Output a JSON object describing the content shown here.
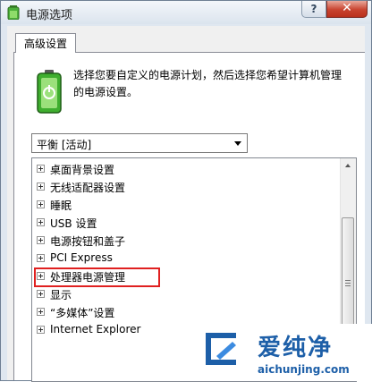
{
  "window": {
    "title": "电源选项",
    "help_label": "?",
    "close_label": "✕"
  },
  "tab": {
    "label": "高级设置"
  },
  "description": "选择您要自定义的电源计划，然后选择您希望计算机管理的电源设置。",
  "plan_select": {
    "value": "平衡 [活动]"
  },
  "tree_items": [
    "桌面背景设置",
    "无线适配器设置",
    "睡眠",
    "USB 设置",
    "电源按钮和盖子",
    "PCI Express",
    "处理器电源管理",
    "显示",
    "“多媒体”设置",
    "Internet Explorer"
  ],
  "highlighted_item": "处理器电源管理",
  "watermark": {
    "name": "爱纯净",
    "url": "aichunjing.com"
  },
  "colors": {
    "highlight_border": "#e02020",
    "watermark_blue": "#1d5fa8",
    "close_red": "#c8432f"
  }
}
